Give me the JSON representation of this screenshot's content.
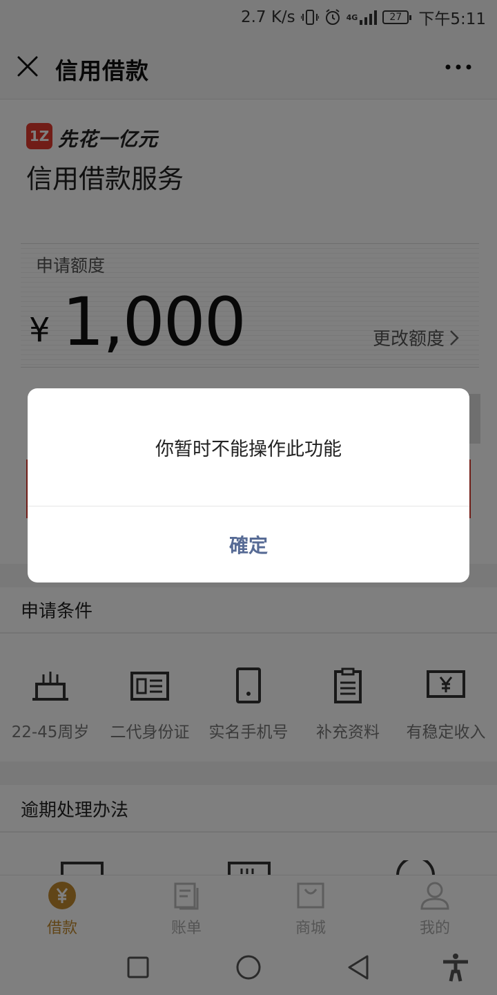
{
  "status_bar": {
    "speed": "2.7 K/s",
    "network": "4G",
    "battery": "27",
    "time": "下午5:11"
  },
  "header": {
    "title": "信用借款"
  },
  "brand": {
    "logo_text": "1Z",
    "name": "先花一亿元",
    "service_title": "信用借款服务"
  },
  "amount": {
    "label": "申请额度",
    "currency": "¥",
    "value": "1,000",
    "change_link": "更改额度"
  },
  "conditions": {
    "title": "申请条件",
    "items": [
      {
        "label": "22-45周岁",
        "icon": "cake-icon"
      },
      {
        "label": "二代身份证",
        "icon": "id-card-icon"
      },
      {
        "label": "实名手机号",
        "icon": "phone-icon"
      },
      {
        "label": "补充资料",
        "icon": "clipboard-icon"
      },
      {
        "label": "有稳定收入",
        "icon": "income-icon"
      }
    ]
  },
  "overdue": {
    "title": "逾期处理办法"
  },
  "tabs": [
    {
      "label": "借款",
      "icon": "yen-circle-icon",
      "active": true
    },
    {
      "label": "账单",
      "icon": "bill-icon",
      "active": false
    },
    {
      "label": "商城",
      "icon": "shopping-bag-icon",
      "active": false
    },
    {
      "label": "我的",
      "icon": "user-icon",
      "active": false
    }
  ],
  "dialog": {
    "message": "你暂时不能操作此功能",
    "confirm_label": "確定"
  },
  "colors": {
    "accent_red": "#e23a2e",
    "tab_active": "#c38a2e",
    "dialog_button": "#576b95"
  }
}
